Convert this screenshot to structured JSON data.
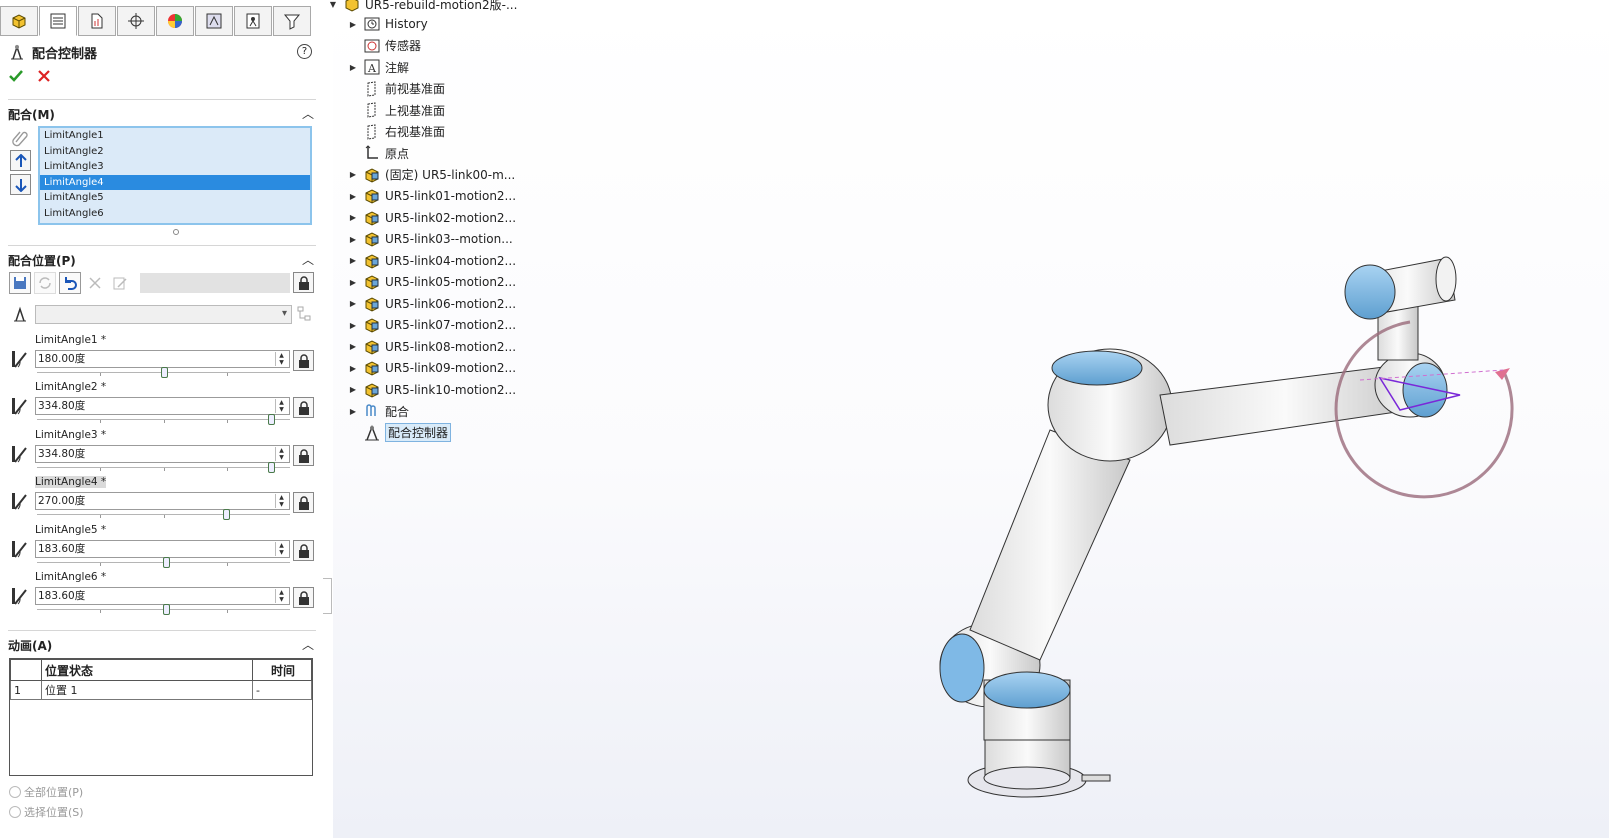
{
  "property_manager": {
    "title": "配合控制器",
    "help": "?",
    "ok_icon": "check-icon",
    "cancel_icon": "close-icon",
    "tabs": [
      "feature-manager-icon",
      "property-manager-icon",
      "configuration-manager-icon",
      "dimxpert-icon",
      "display-manager-icon",
      "cam-icon",
      "motion-icon",
      "filter-icon"
    ]
  },
  "mates_section": {
    "header": "配合(M)",
    "items": [
      "LimitAngle1",
      "LimitAngle2",
      "LimitAngle3",
      "LimitAngle4",
      "LimitAngle5",
      "LimitAngle6"
    ],
    "selected_index": 3
  },
  "positions_section": {
    "header": "配合位置(P)",
    "limits": [
      {
        "label": "LimitAngle1 *",
        "value": "180.00度",
        "slider": 0.5
      },
      {
        "label": "LimitAngle2 *",
        "value": "334.80度",
        "slider": 0.93
      },
      {
        "label": "LimitAngle3 *",
        "value": "334.80度",
        "slider": 0.93
      },
      {
        "label": "LimitAngle4 *",
        "value": "270.00度",
        "slider": 0.75
      },
      {
        "label": "LimitAngle5 *",
        "value": "183.60度",
        "slider": 0.51
      },
      {
        "label": "LimitAngle6 *",
        "value": "183.60度",
        "slider": 0.51
      }
    ]
  },
  "animation_section": {
    "header": "动画(A)",
    "columns": [
      "",
      "位置状态",
      "时间"
    ],
    "rows": [
      [
        "1",
        "位置 1",
        "-"
      ]
    ],
    "radio_all": "全部位置(P)",
    "radio_select": "选择位置(S)"
  },
  "tree": {
    "root": "UR5-rebuild-motion2版-...",
    "nodes": [
      {
        "label": "History",
        "icon": "history-icon",
        "expand": true
      },
      {
        "label": "传感器",
        "icon": "sensor-icon",
        "expand": false
      },
      {
        "label": "注解",
        "icon": "annotation-icon",
        "expand": true
      },
      {
        "label": "前视基准面",
        "icon": "plane-icon",
        "expand": false
      },
      {
        "label": "上视基准面",
        "icon": "plane-icon",
        "expand": false
      },
      {
        "label": "右视基准面",
        "icon": "plane-icon",
        "expand": false
      },
      {
        "label": "原点",
        "icon": "origin-icon",
        "expand": false
      },
      {
        "label": "(固定) UR5-link00-m...",
        "icon": "part-icon",
        "expand": true
      },
      {
        "label": "UR5-link01-motion2...",
        "icon": "part-icon",
        "expand": true
      },
      {
        "label": "UR5-link02-motion2...",
        "icon": "part-icon",
        "expand": true
      },
      {
        "label": "UR5-link03--motion...",
        "icon": "part-icon",
        "expand": true
      },
      {
        "label": "UR5-link04-motion2...",
        "icon": "part-icon",
        "expand": true
      },
      {
        "label": "UR5-link05-motion2...",
        "icon": "part-icon",
        "expand": true
      },
      {
        "label": "UR5-link06-motion2...",
        "icon": "part-icon",
        "expand": true
      },
      {
        "label": "UR5-link07-motion2...",
        "icon": "part-icon",
        "expand": true
      },
      {
        "label": "UR5-link08-motion2...",
        "icon": "part-icon",
        "expand": true
      },
      {
        "label": "UR5-link09-motion2...",
        "icon": "part-icon",
        "expand": true
      },
      {
        "label": "UR5-link10-motion2...",
        "icon": "part-icon",
        "expand": true
      },
      {
        "label": "配合",
        "icon": "mates-icon",
        "expand": true
      },
      {
        "label": "配合控制器",
        "icon": "mate-controller-icon",
        "expand": false,
        "selected": true
      }
    ]
  },
  "colors": {
    "accent": "#2a8be0",
    "list_bg": "#dbeaf8",
    "robot_blue": "#7fb9e6"
  }
}
